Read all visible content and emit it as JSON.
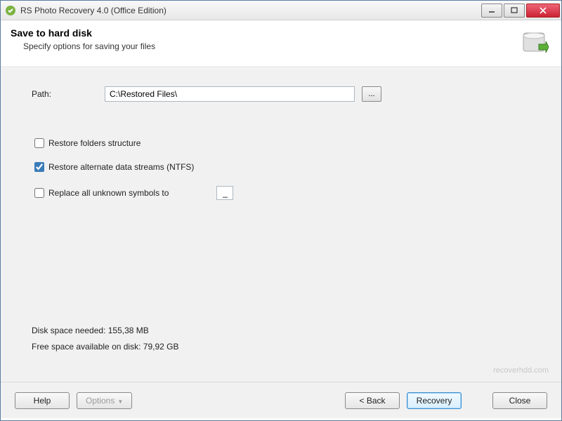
{
  "window": {
    "title": "RS Photo Recovery 4.0 (Office Edition)"
  },
  "header": {
    "title": "Save to hard disk",
    "subtitle": "Specify options for saving your files"
  },
  "path": {
    "label": "Path:",
    "value": "C:\\Restored Files\\",
    "browse": "..."
  },
  "options": {
    "restore_folders": {
      "label": "Restore folders structure",
      "checked": false
    },
    "restore_ads": {
      "label": "Restore alternate data streams (NTFS)",
      "checked": true
    },
    "replace_symbols": {
      "label": "Replace all unknown symbols to",
      "checked": false,
      "char": "_"
    }
  },
  "disk": {
    "needed_label": "Disk space needed:",
    "needed_value": "155,38 MB",
    "free_label": "Free space available on disk:",
    "free_value": "79,92 GB"
  },
  "watermark": "recoverhdd.com",
  "footer": {
    "help": "Help",
    "options": "Options",
    "back": "< Back",
    "recovery": "Recovery",
    "close": "Close"
  }
}
